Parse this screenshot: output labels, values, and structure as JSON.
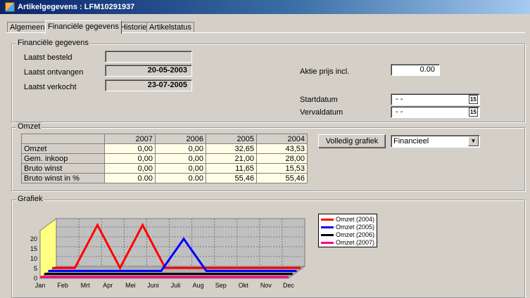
{
  "window": {
    "title": "Artikelgegevens : LFM10291937"
  },
  "tabs": [
    {
      "label": "Algemeen"
    },
    {
      "label": "Financiële gegevens",
      "active": true
    },
    {
      "label": "Historie"
    },
    {
      "label": "Artikelstatus"
    }
  ],
  "financial": {
    "group_title": "Financiële gegevens",
    "laatst_besteld_label": "Laatst besteld",
    "laatst_besteld_value": "",
    "laatst_ontvangen_label": "Laatst ontvangen",
    "laatst_ontvangen_value": "20-05-2003",
    "laatst_verkocht_label": "Laatst verkocht",
    "laatst_verkocht_value": "23-07-2005",
    "aktie_prijs_label": "Aktie prijs incl.",
    "aktie_prijs_value": "0.00",
    "startdatum_label": "Startdatum",
    "startdatum_value": "- -",
    "vervaldatum_label": "Vervaldatum",
    "vervaldatum_value": "- -",
    "calendar_icon_text": "15"
  },
  "omzet": {
    "group_title": "Omzet",
    "years": [
      "2007",
      "2006",
      "2005",
      "2004"
    ],
    "rows": [
      {
        "label": "Omzet",
        "values": [
          "0,00",
          "0,00",
          "32,65",
          "43,53"
        ]
      },
      {
        "label": "Gem. inkoop",
        "values": [
          "0,00",
          "0,00",
          "21,00",
          "28,00"
        ]
      },
      {
        "label": "Bruto winst",
        "values": [
          "0,00",
          "0,00",
          "11,65",
          "15,53"
        ]
      },
      {
        "label": "Bruto winst in %",
        "values": [
          "0.00",
          "0.00",
          "55,46",
          "55,46"
        ]
      }
    ],
    "volledig_grafiek_label": "Volledig grafiek",
    "grafiek_type_selected": "Financieel"
  },
  "grafiek": {
    "group_title": "Grafiek"
  },
  "chart_data": {
    "type": "line",
    "categories": [
      "Jan",
      "Feb",
      "Mrt",
      "Apr",
      "Mei",
      "Juni",
      "Juli",
      "Aug",
      "Sep",
      "Okt",
      "Nov",
      "Dec"
    ],
    "yticks": [
      "0",
      "5",
      "10",
      "15",
      "20"
    ],
    "ylim": [
      0,
      20
    ],
    "three_d": true,
    "grid": true,
    "legend_position": "right",
    "series": [
      {
        "name": "Omzet (2004)",
        "color": "#ff0000",
        "values": [
          0,
          0,
          21.8,
          0,
          21.8,
          0,
          0,
          0,
          0,
          0,
          0,
          0
        ]
      },
      {
        "name": "Omzet (2005)",
        "color": "#0000ff",
        "values": [
          0,
          0,
          0,
          0,
          0,
          0,
          16.3,
          0,
          0,
          0,
          0,
          0
        ]
      },
      {
        "name": "Omzet (2006)",
        "color": "#000000",
        "values": [
          0,
          0,
          0,
          0,
          0,
          0,
          0,
          0,
          0,
          0,
          0,
          0
        ]
      },
      {
        "name": "Omzet (2007)",
        "color": "#ff0080",
        "values": [
          0,
          0,
          0,
          0,
          0,
          0,
          0,
          0,
          0,
          0,
          0,
          0
        ]
      }
    ]
  }
}
